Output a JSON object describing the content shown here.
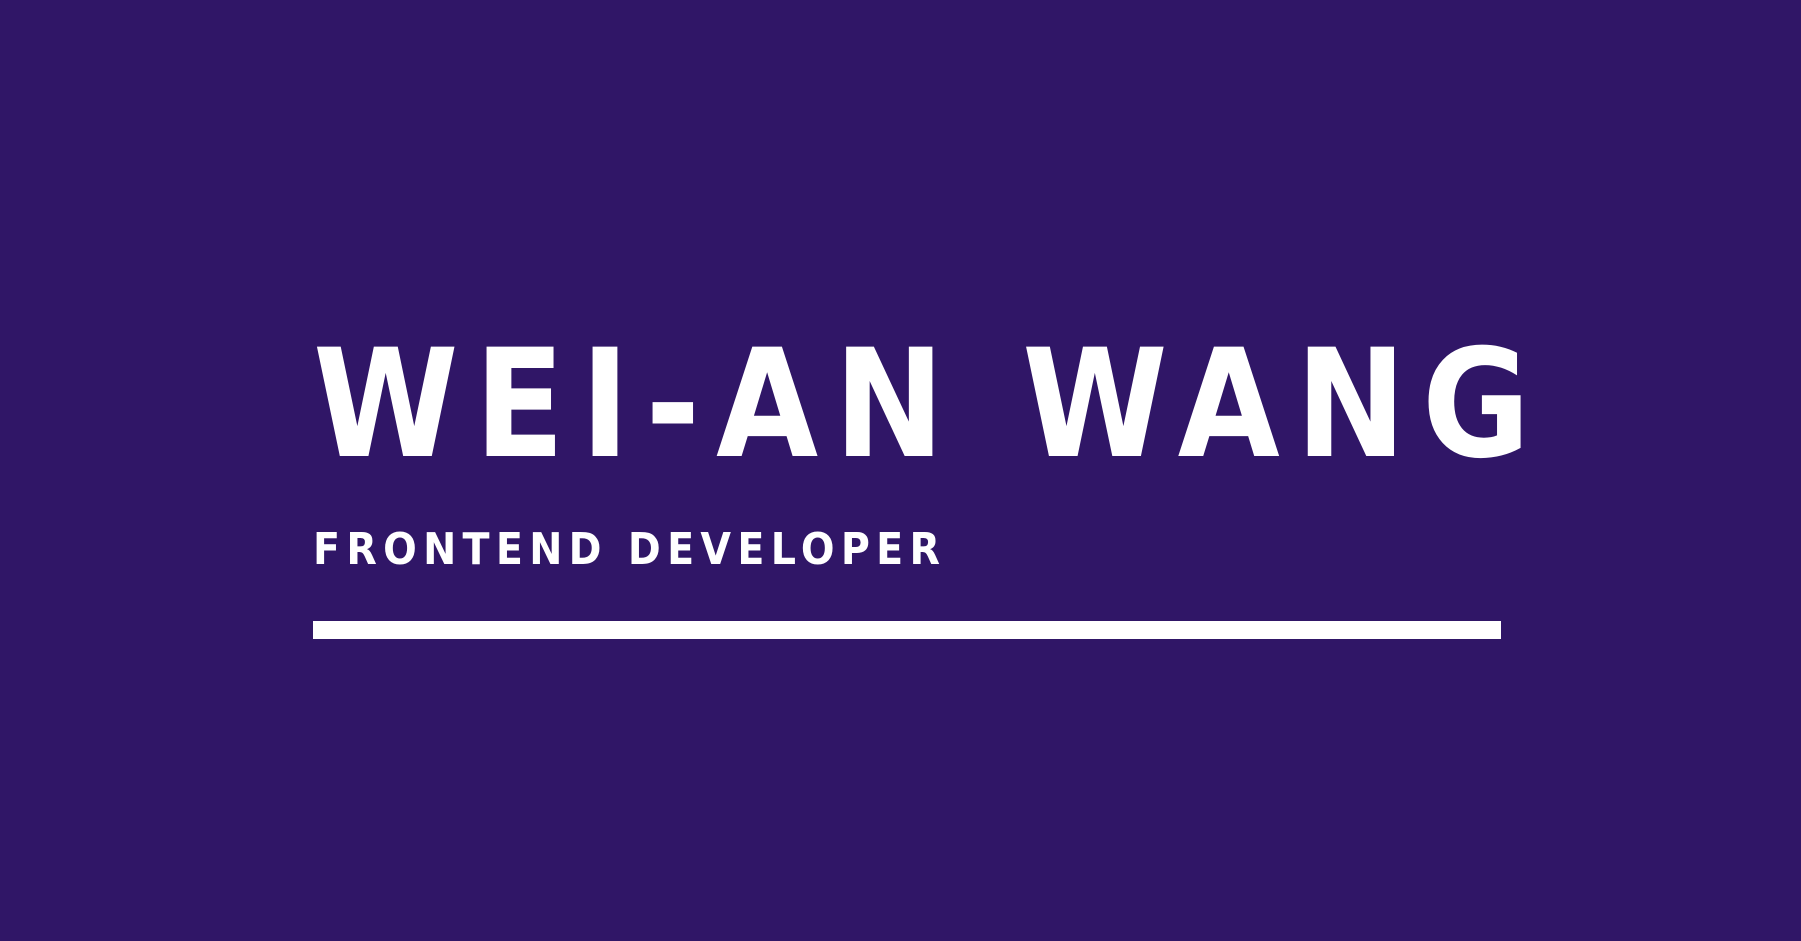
{
  "hero": {
    "name": "WEI-AN WANG",
    "role": "FRONTEND DEVELOPER"
  },
  "colors": {
    "background": "#301667",
    "text": "#ffffff",
    "rule": "#ffffff"
  }
}
